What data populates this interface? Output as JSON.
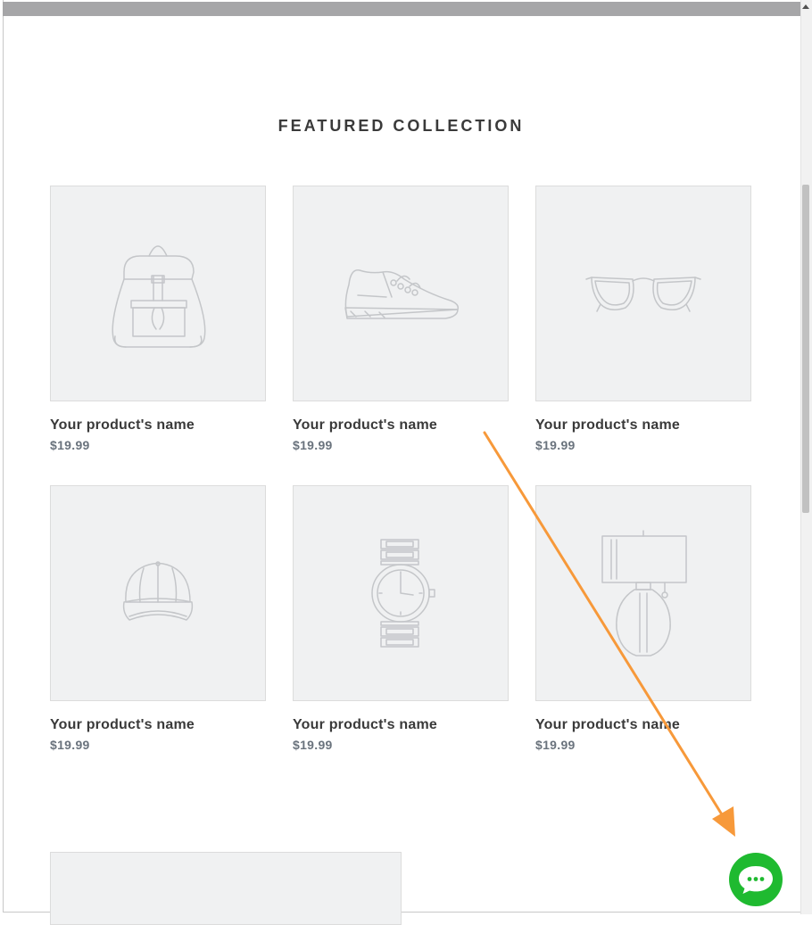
{
  "section": {
    "title": "FEATURED COLLECTION"
  },
  "products": [
    {
      "icon": "backpack-icon",
      "name": "Your product's name",
      "price": "$19.99"
    },
    {
      "icon": "sneaker-icon",
      "name": "Your product's name",
      "price": "$19.99"
    },
    {
      "icon": "glasses-icon",
      "name": "Your product's name",
      "price": "$19.99"
    },
    {
      "icon": "cap-icon",
      "name": "Your product's name",
      "price": "$19.99"
    },
    {
      "icon": "watch-icon",
      "name": "Your product's name",
      "price": "$19.99"
    },
    {
      "icon": "lamp-icon",
      "name": "Your product's name",
      "price": "$19.99"
    }
  ],
  "chat": {
    "icon": "chat-bubble-icon",
    "color": "#1fba30"
  },
  "annotation": {
    "icon": "arrow-annotation",
    "color": "#f7993a"
  }
}
